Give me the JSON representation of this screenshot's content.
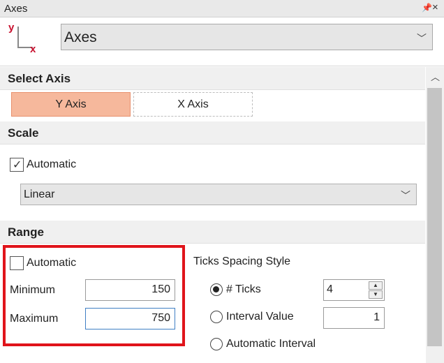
{
  "window": {
    "title": "Axes"
  },
  "header": {
    "axis_icon_y": "y",
    "axis_icon_x": "x",
    "selector_value": "Axes"
  },
  "select_axis": {
    "heading": "Select Axis",
    "y_label": "Y Axis",
    "x_label": "X Axis",
    "selected": "Y Axis"
  },
  "scale": {
    "heading": "Scale",
    "automatic_label": "Automatic",
    "automatic_checked": true,
    "type_value": "Linear"
  },
  "range": {
    "heading": "Range",
    "automatic_label": "Automatic",
    "automatic_checked": false,
    "minimum_label": "Minimum",
    "minimum_value": "150",
    "maximum_label": "Maximum",
    "maximum_value": "750"
  },
  "ticks": {
    "heading": "Ticks Spacing Style",
    "options": [
      "# Ticks",
      "Interval Value",
      "Automatic Interval"
    ],
    "selected": "# Ticks",
    "ticks_value": "4",
    "interval_value": "1"
  },
  "colors": {
    "highlight": "#e0141b",
    "selected_axis": "#f6b89c",
    "icon_red": "#c8102e"
  }
}
